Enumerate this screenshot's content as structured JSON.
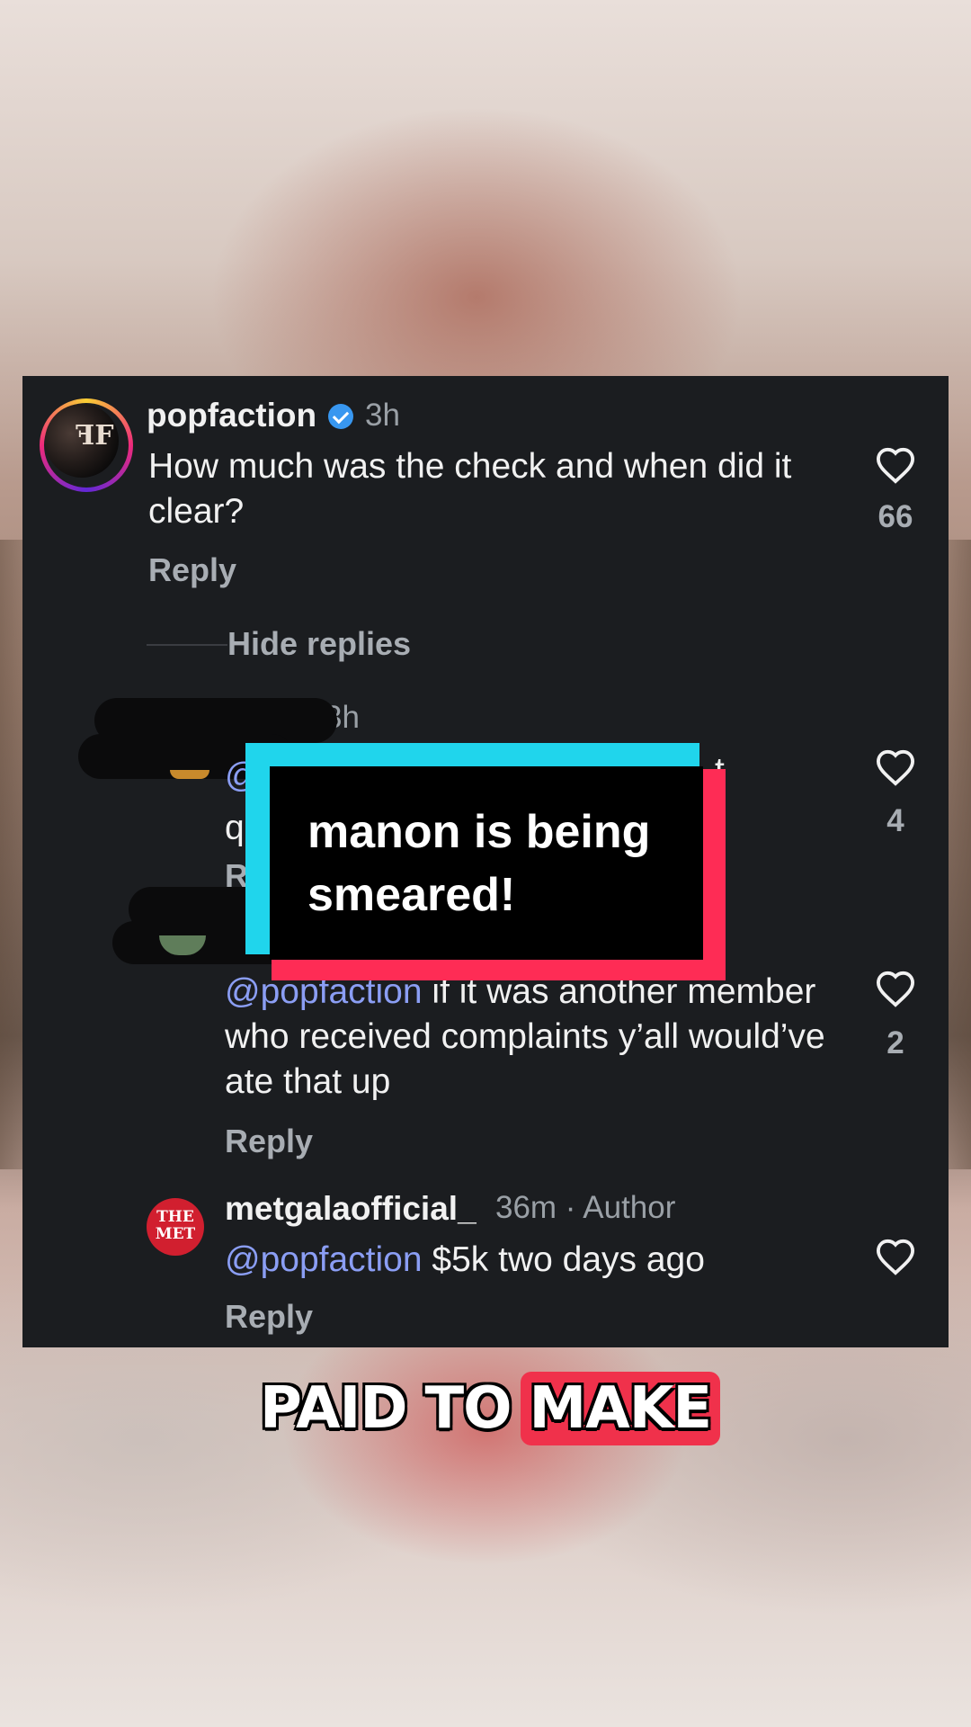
{
  "comments": [
    {
      "username": "popfaction",
      "verified": true,
      "time": "3h",
      "text": "How much was the check and when did it clear?",
      "reply_label": "Reply",
      "likes": "66"
    },
    {
      "time": "3h",
      "text_visible_start": "@",
      "text_visible_line2": "q",
      "text_visible_end": "t",
      "reply_label": "R",
      "likes": "4"
    },
    {
      "mention": "@popfaction",
      "text": " if it was another member who received complaints y’all would’ve ate that up",
      "reply_label": "Reply",
      "likes": "2"
    },
    {
      "username": "metgalaofficial_",
      "meta": "36m · Author",
      "mention": "@popfaction",
      "text": " $5k two days ago",
      "reply_label": "Reply",
      "avatar_text_line1": "THE",
      "avatar_text_line2": "MET"
    }
  ],
  "hide_replies_label": "Hide replies",
  "avatar_monogram": "ꟻF",
  "overlay": {
    "text": "manon is being smeared!"
  },
  "caption": {
    "word1": "PAID",
    "word2": "TO",
    "word3": "MAKE"
  },
  "colors": {
    "card_bg": "#1b1d20",
    "mention": "#8b9ef4",
    "tiktok_cyan": "#20d5ec",
    "tiktok_red": "#fe2c55",
    "caption_highlight": "#f0314b"
  }
}
